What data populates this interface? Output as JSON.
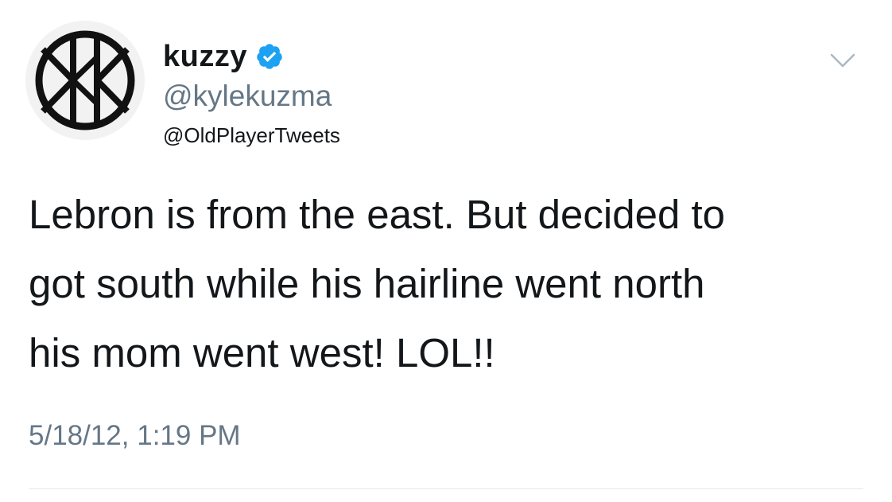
{
  "author": {
    "display_name": "kuzzy",
    "handle": "@kylekuzma",
    "verified": true,
    "avatar_icon": "kk-logo-icon"
  },
  "watermark": "@OldPlayerTweets",
  "tweet": {
    "text": "Lebron is from the east. But decided to\ngot south while his hairline went north\nhis mom went west! LOL!!",
    "timestamp": "5/18/12, 1:19 PM"
  },
  "colors": {
    "text": "#14171a",
    "secondary": "#657786",
    "verified_badge": "#1da1f2",
    "divider": "#e1e8ed"
  }
}
